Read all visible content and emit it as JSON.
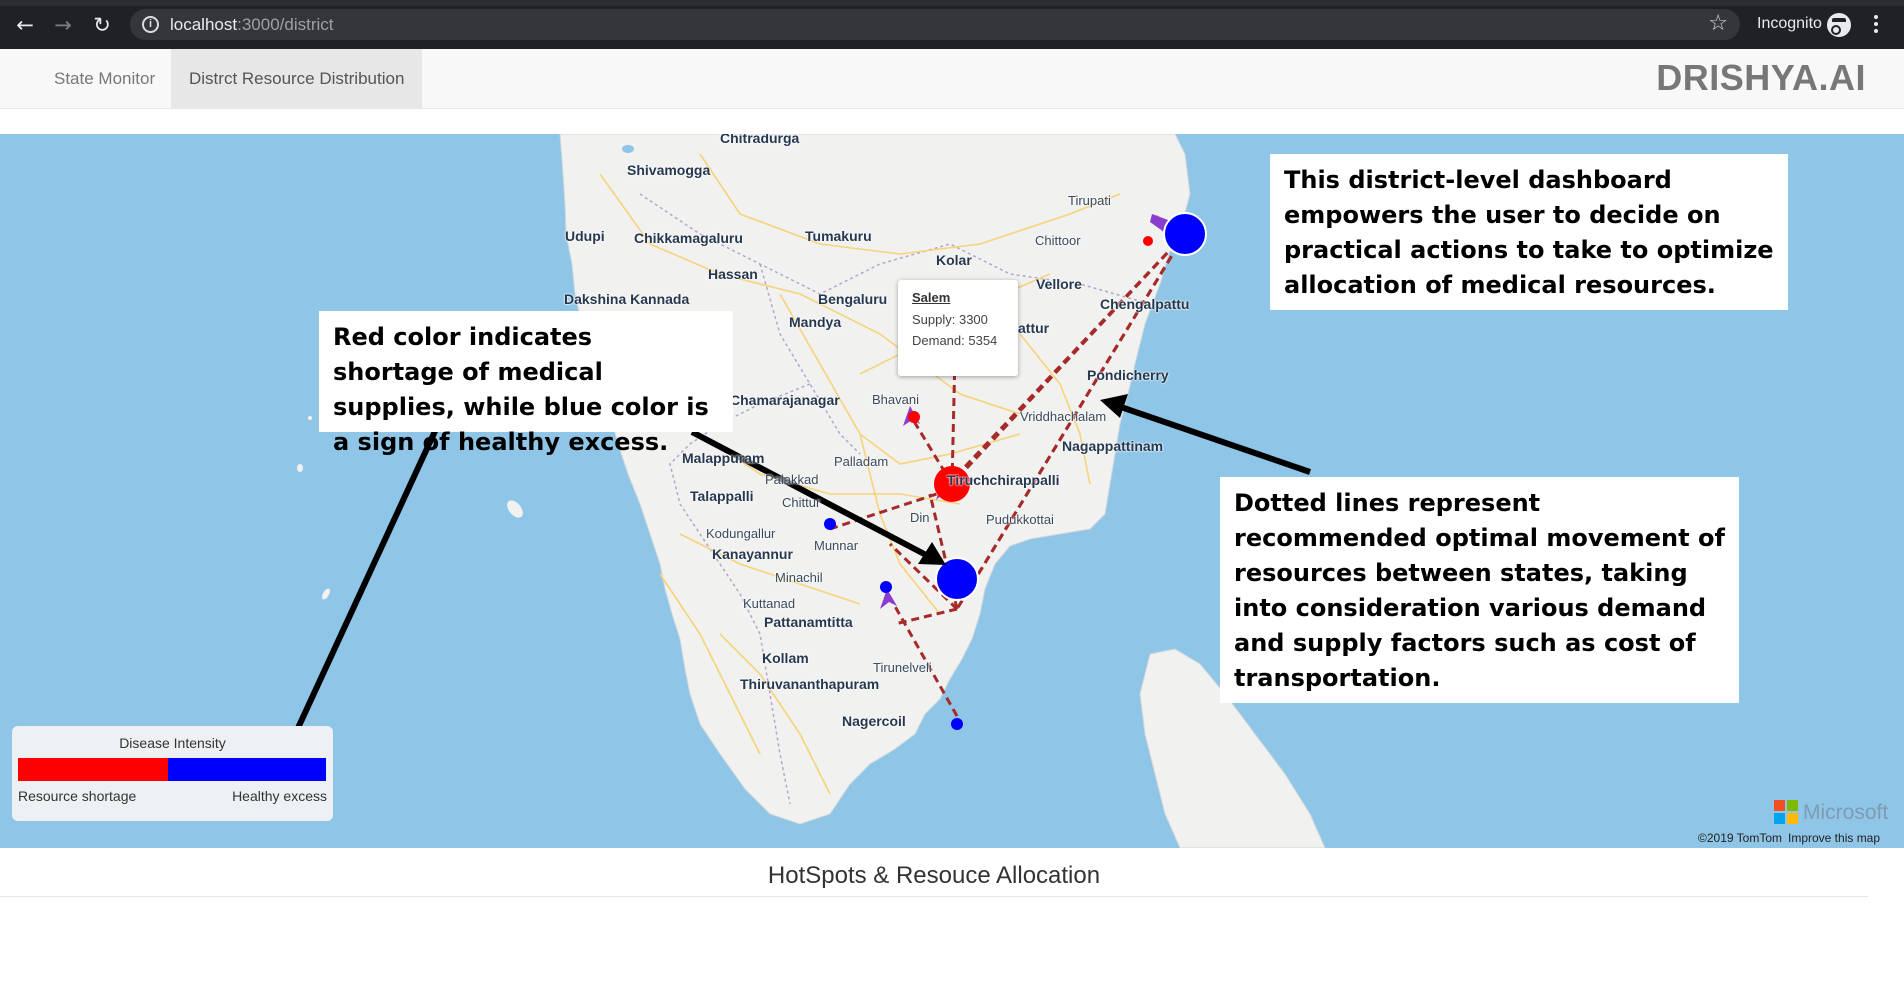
{
  "browser": {
    "url_host": "localhost",
    "url_rest": ":3000/district",
    "incognito_label": "Incognito"
  },
  "nav": {
    "tabs": [
      {
        "label": "State Monitor",
        "active": false
      },
      {
        "label": "Distrct Resource Distribution",
        "active": true
      }
    ],
    "brand": "DRISHYA.AI"
  },
  "map": {
    "places": {
      "chitradurga": "Chitradurga",
      "shivamogga": "Shivamogga",
      "tirupati": "Tirupati",
      "udupi": "Udupi",
      "chikkamagaluru": "Chikkamagaluru",
      "tumakuru": "Tumakuru",
      "chittoor": "Chittoor",
      "kolar": "Kolar",
      "hassan": "Hassan",
      "vellore": "Vellore",
      "dakshina_kannada": "Dakshina Kannada",
      "bengaluru": "Bengaluru",
      "chengalpattu": "Chengalpattu",
      "mandya": "Mandya",
      "attur": "attur",
      "pondicherry": "Pondicherry",
      "chamarajanagar": "Chamarajanagar",
      "bhavani": "Bhavani",
      "vriddhachalam": "Vriddhachalam",
      "nagappattinam": "Nagappattinam",
      "malappuram": "Malappuram",
      "palladam": "Palladam",
      "palakkad": "Palakkad",
      "tiruchchirappalli": "Tiruchchirappalli",
      "talappalli": "Talappalli",
      "chittur": "Chittur",
      "dindigul": "Din",
      "pudukkottai": "Pudukkottai",
      "kodungallur": "Kodungallur",
      "kanayannur": "Kanayannur",
      "munnar": "Munnar",
      "minachil": "Minachil",
      "kuttanad": "Kuttanad",
      "pattanamtitta": "Pattanamtitta",
      "kollam": "Kollam",
      "tirunelveli": "Tirunelveli",
      "thiruvananthapuram": "Thiruvananthapuram",
      "nagercoil": "Nagercoil"
    },
    "tooltip": {
      "title": "Salem",
      "supply": "Supply: 3300",
      "demand": "Demand: 5354"
    },
    "colors": {
      "shortage": "#ff0000",
      "excess": "#0000ff",
      "route": "#a52a2a",
      "arrow": "#8a3ccf"
    },
    "legend": {
      "title": "Disease Intensity",
      "left_label": "Resource shortage",
      "right_label": "Healthy excess"
    },
    "attribution": {
      "logo_text": "Microsoft",
      "copyright": "©2019 TomTom",
      "improve": "Improve this map"
    }
  },
  "annotations": {
    "top": "This district-level dashboard empowers the user to decide on practical actions to take to optimize allocation of medical resources.",
    "left": "Red color indicates shortage of medical supplies, while blue color is a sign of healthy excess.",
    "right": "Dotted lines represent recommended optimal movement of resources between states, taking into consideration various demand and supply factors such as cost of transportation."
  },
  "footer": {
    "title": "HotSpots & Resouce Allocation"
  }
}
